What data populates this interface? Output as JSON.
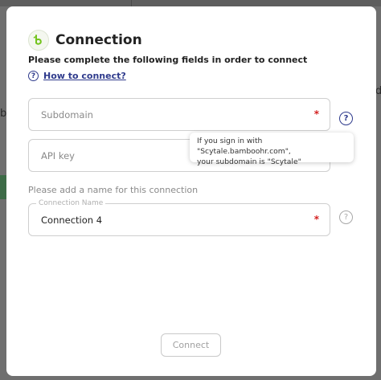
{
  "background": {
    "letters": [
      "b",
      "d"
    ]
  },
  "modal": {
    "title": "Connection",
    "logo_icon": "bamboohr-logo-icon",
    "brand_color": "#73c41d",
    "link_color": "#2e3a8c",
    "required_color": "#d32020",
    "subtitle": "Please complete the following fields in order to connect",
    "how_to_link": "How to connect?",
    "help_glyph": "?",
    "fields": {
      "subdomain": {
        "placeholder": "Subdomain",
        "value": "",
        "required": "*"
      },
      "api_key": {
        "placeholder": "API key",
        "value": ""
      },
      "connection_name": {
        "label": "Connection Name",
        "value": "Connection 4",
        "required": "*"
      }
    },
    "tooltip": {
      "line1": "If you sign in with \"Scytale.bamboohr.com\",",
      "line2": "your subdomain is \"Scytale\""
    },
    "name_prompt": "Please add a name for this connection",
    "connect_button": "Connect"
  }
}
